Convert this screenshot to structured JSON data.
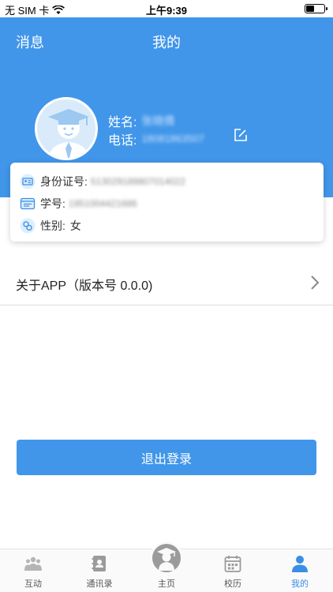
{
  "status_bar": {
    "carrier": "无 SIM 卡",
    "time": "上午9:39",
    "wifi_icon": "wifi-icon",
    "battery_icon": "battery-icon"
  },
  "header": {
    "nav_left": "消息",
    "title": "我的"
  },
  "profile": {
    "name_label": "姓名:",
    "name_value": "张晓倩",
    "phone_label": "电话:",
    "phone_value": "18081863507",
    "avatar_icon": "graduate-avatar-icon",
    "edit_icon": "edit-icon"
  },
  "info": {
    "id_label": "身份证号:",
    "id_value": "513029189807014022",
    "student_label": "学号:",
    "student_value": "1951004421686",
    "gender_label": "性别:",
    "gender_value": "女"
  },
  "about": {
    "label": "关于APP（版本号 0.0.0)",
    "chevron_icon": "chevron-right-icon"
  },
  "logout_label": "退出登录",
  "tabs": [
    {
      "label": "互动",
      "icon": "people-icon"
    },
    {
      "label": "通讯录",
      "icon": "contacts-icon"
    },
    {
      "label": "主页",
      "icon": "home-graduate-icon"
    },
    {
      "label": "校历",
      "icon": "calendar-icon"
    },
    {
      "label": "我的",
      "icon": "person-icon"
    }
  ],
  "colors": {
    "primary": "#4196ea",
    "active_tab": "#3a8ee6"
  }
}
